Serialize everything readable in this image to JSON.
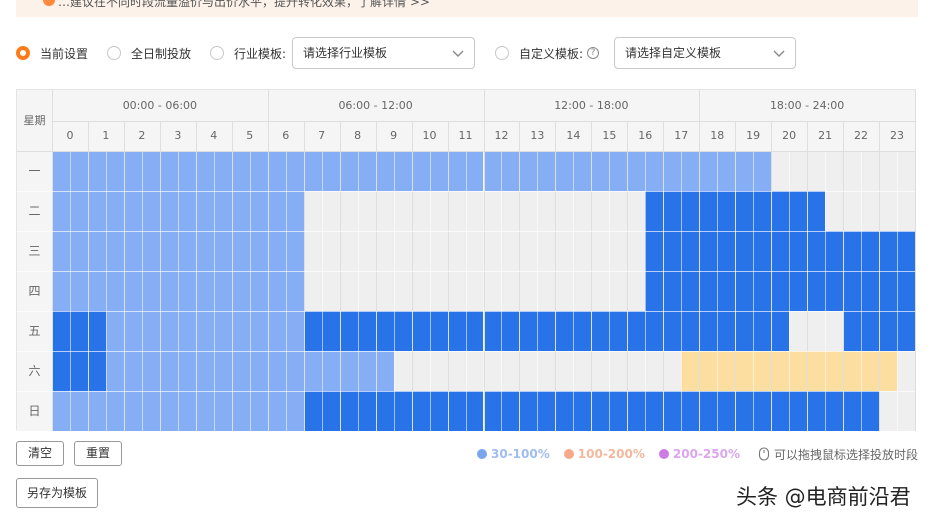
{
  "notice": {
    "text": "…建议在不同时段流量溢价与出价水平，提升转化效果，了解详情 >>"
  },
  "options": {
    "current": "当前设置",
    "all_day": "全日制投放",
    "industry_label": "行业模板:",
    "industry_placeholder": "请选择行业模板",
    "custom_label": "自定义模板:",
    "custom_placeholder": "请选择自定义模板",
    "help_glyph": "?"
  },
  "grid": {
    "corner": "星期",
    "time_ranges": [
      "00:00 - 06:00",
      "06:00 - 12:00",
      "12:00 - 18:00",
      "18:00 - 24:00"
    ],
    "hours": [
      "0",
      "1",
      "2",
      "3",
      "4",
      "5",
      "6",
      "7",
      "8",
      "9",
      "10",
      "11",
      "12",
      "13",
      "14",
      "15",
      "16",
      "17",
      "18",
      "19",
      "20",
      "21",
      "22",
      "23"
    ],
    "days": [
      "一",
      "二",
      "三",
      "四",
      "五",
      "六",
      "日"
    ],
    "rows": [
      "LLLLLLLLLLLLLLLLLLLLLLLLLLLLLLLLLLLLLLLLEEEEEEEEE",
      "LLLLLLLLLLLLLLEEEEEEEEEEEEEEEEEEEDDDDDDDDDDEEEEEEEEEEEEEEEE",
      "LLLLLLLLLLLLLLEEEEEEEEEEEEEEEEEEEDDDDDDDDDDDDDDDDDDDDDDDDDDD",
      "LLLLLLLLLLLLLLEEEEEEEEEEEEEEEEEEEDDDDDDDDDDDDDDDDEEEEEEEEE",
      "DDDLLLLLLLLLLLDDDDDDDDDDDDDDDDDDDDDDDDDDDEEEDDDDDDDDEEEEEEEE",
      "DDDLLLLLLLLLLLLLLLLEEEEEEEEEEEEEEEEOOOOOOOOOOOOEEEEEEEEEEEEEEE",
      "LLLLLLLLLLLLLLDDDDDDDDDDDDDDDDDDDDDDDDDDDDDDDDEEEEEEEEEEEEEEE"
    ],
    "colors": {
      "L": "#86aef4",
      "D": "#2873e8",
      "O": "#fbdea0",
      "E": "#efefef"
    }
  },
  "buttons": {
    "clear": "清空",
    "reset": "重置",
    "save_template": "另存为模板"
  },
  "legend": [
    {
      "label": "30-100%",
      "color": "#7aa6ee",
      "text_color": "#9fbdf0"
    },
    {
      "label": "100-200%",
      "color": "#f7a98a",
      "text_color": "#f3b89e"
    },
    {
      "label": "200-250%",
      "color": "#cf7be6",
      "text_color": "#dba6ec"
    }
  ],
  "hint": {
    "icon": "mouse-icon",
    "text": "可以拖拽鼠标选择投放时段"
  },
  "watermark": "头条 @电商前沿君"
}
